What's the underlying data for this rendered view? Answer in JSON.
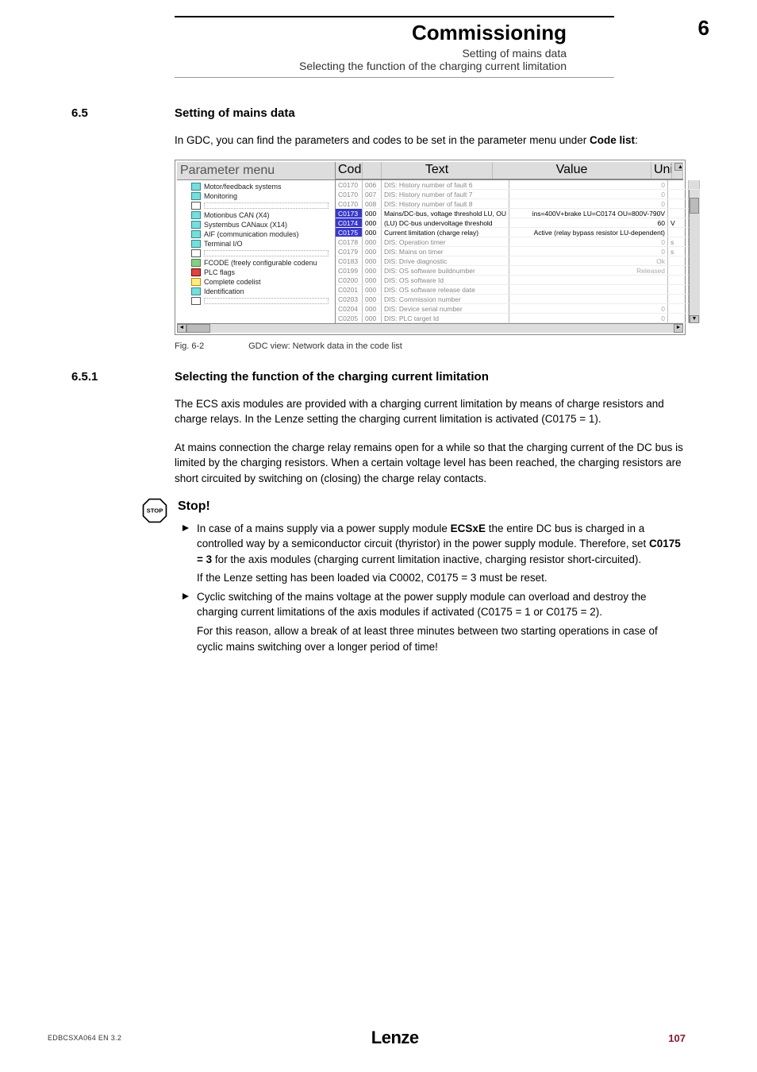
{
  "header": {
    "title": "Commissioning",
    "sub1": "Setting of mains data",
    "sub2": "Selecting the function of the charging current limitation",
    "page_num": "6"
  },
  "sec65": {
    "num": "6.5",
    "title": "Setting of mains data",
    "para": "In GDC, you can find the parameters and codes to be set in the parameter menu under ",
    "para_bold": "Code list",
    "para_after": ":"
  },
  "gdc": {
    "tree_header": "Parameter menu",
    "tree": [
      "Motor/feedback systems",
      "Monitoring",
      "DOTTED",
      "Motionbus CAN (X4)",
      "Systembus CANaux (X14)",
      "AIF (communication modules)",
      "Terminal I/O",
      "DOTTED",
      "FCODE (freely configurable codenu",
      "PLC flags",
      "Complete codelist",
      "Identification",
      "DOTTED"
    ],
    "tree_classes": [
      "b1",
      "b1",
      "",
      "b1",
      "b1",
      "b1",
      "b1",
      "",
      "g",
      "r",
      "y",
      "b1",
      ""
    ],
    "cols": {
      "code": "Code",
      "text": "Text",
      "value": "Value",
      "unit": "Unit"
    },
    "rows": [
      {
        "code": "C0170",
        "sub": "006",
        "text": "DIS: History number of fault 6",
        "value": "0",
        "unit": "",
        "cls": "faded"
      },
      {
        "code": "C0170",
        "sub": "007",
        "text": "DIS: History number of fault 7",
        "value": "0",
        "unit": "",
        "cls": "faded"
      },
      {
        "code": "C0170",
        "sub": "008",
        "text": "DIS: History number of fault 8",
        "value": "0",
        "unit": "",
        "cls": "faded"
      },
      {
        "code": "C0173",
        "sub": "000",
        "text": "Mains/DC-bus, voltage threshold LU, OU",
        "value": "ins=400V+brake   LU=C0174  OU=800V-790V",
        "unit": "",
        "cls": "active"
      },
      {
        "code": "C0174",
        "sub": "000",
        "text": "(LU)  DC-bus undervoltage threshold",
        "value": "60",
        "unit": "V",
        "cls": "active"
      },
      {
        "code": "C0175",
        "sub": "000",
        "text": "Current limitation (charge relay)",
        "value": "Active  (relay bypass resistor LU-dependent)",
        "unit": "",
        "cls": "active"
      },
      {
        "code": "C0178",
        "sub": "000",
        "text": "DIS: Operation timer",
        "value": "0",
        "unit": "s",
        "cls": "faded"
      },
      {
        "code": "C0179",
        "sub": "000",
        "text": "DIS: Mains on timer",
        "value": "0",
        "unit": "s",
        "cls": "faded"
      },
      {
        "code": "C0183",
        "sub": "000",
        "text": "DIS: Drive diagnostic",
        "value": "Ok",
        "unit": "",
        "cls": "faded"
      },
      {
        "code": "C0199",
        "sub": "000",
        "text": "DIS: OS software buildnumber",
        "value": "Released",
        "unit": "",
        "cls": "faded"
      },
      {
        "code": "C0200",
        "sub": "000",
        "text": "DIS: OS software Id",
        "value": "",
        "unit": "",
        "cls": "faded"
      },
      {
        "code": "C0201",
        "sub": "000",
        "text": "DIS: OS software release date",
        "value": "",
        "unit": "",
        "cls": "faded"
      },
      {
        "code": "C0203",
        "sub": "000",
        "text": "DIS: Commission number",
        "value": "",
        "unit": "",
        "cls": "faded"
      },
      {
        "code": "C0204",
        "sub": "000",
        "text": "DIS: Device serial number",
        "value": "0",
        "unit": "",
        "cls": "faded"
      },
      {
        "code": "C0205",
        "sub": "000",
        "text": "DIS: PLC target Id",
        "value": "0",
        "unit": "",
        "cls": "faded"
      }
    ]
  },
  "figcap": {
    "num": "Fig. 6-2",
    "text": "GDC view: Network data in the code list"
  },
  "sec651": {
    "num": "6.5.1",
    "title": "Selecting the function of the charging current limitation",
    "p1": "The ECS axis modules are provided with a charging current limitation by means of charge resistors and charge relays. In the Lenze setting the charging current limitation is activated (C0175 = 1).",
    "p2": "At mains connection the charge relay remains open for a while so that the charging current of the DC bus is limited by the charging resistors. When a certain voltage level has been reached, the charging resistors are short circuited by switching on (closing) the charge relay contacts."
  },
  "stop": {
    "label": "STOP",
    "heading": "Stop!",
    "b1a": "In case of a mains supply via a power supply module ",
    "b1b": "ECSxE",
    "b1c": " the entire DC bus is charged in a controlled way by a semiconductor circuit (thyristor) in the power supply module. Therefore, set ",
    "b1d": "C0175 = 3",
    "b1e": " for the axis modules (charging current limitation inactive, charging resistor short-circuited).",
    "b1f": "If the Lenze setting has been loaded via C0002, C0175 = 3 must be reset.",
    "b2a": "Cyclic switching of the mains voltage at the power supply module can overload and destroy the charging current limitations of the axis modules if activated (C0175 = 1 or C0175 = 2).",
    "b2b": "For this reason, allow a break of at least three minutes between two starting operations in case of cyclic mains switching over a longer period of time!"
  },
  "footer": {
    "left": "EDBCSXA064  EN  3.2",
    "logo": "Lenze",
    "right": "107"
  }
}
